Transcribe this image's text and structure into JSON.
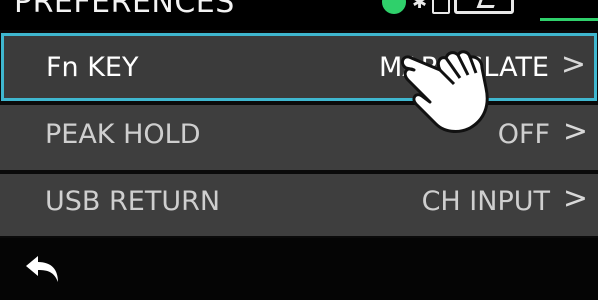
{
  "header": {
    "title": "PREFERENCES"
  },
  "status": {
    "indicator_color": "#2fd06b",
    "icons": [
      "status-dot-icon",
      "bluetooth-icon",
      "lock-icon",
      "battery-icon",
      "level-meter-icon"
    ]
  },
  "menu": {
    "items": [
      {
        "label": "Fn KEY",
        "value": "MARK/SLATE",
        "chevron": ">"
      },
      {
        "label": "PEAK HOLD",
        "value": "OFF",
        "chevron": ">"
      },
      {
        "label": "USB RETURN",
        "value": "CH INPUT",
        "chevron": ">"
      }
    ],
    "selected_index": 0,
    "selection_color": "#3fb7cf"
  },
  "footer": {
    "back_icon": "back-arrow-icon"
  },
  "overlay": {
    "hand_icon": "tap-hand-icon"
  }
}
